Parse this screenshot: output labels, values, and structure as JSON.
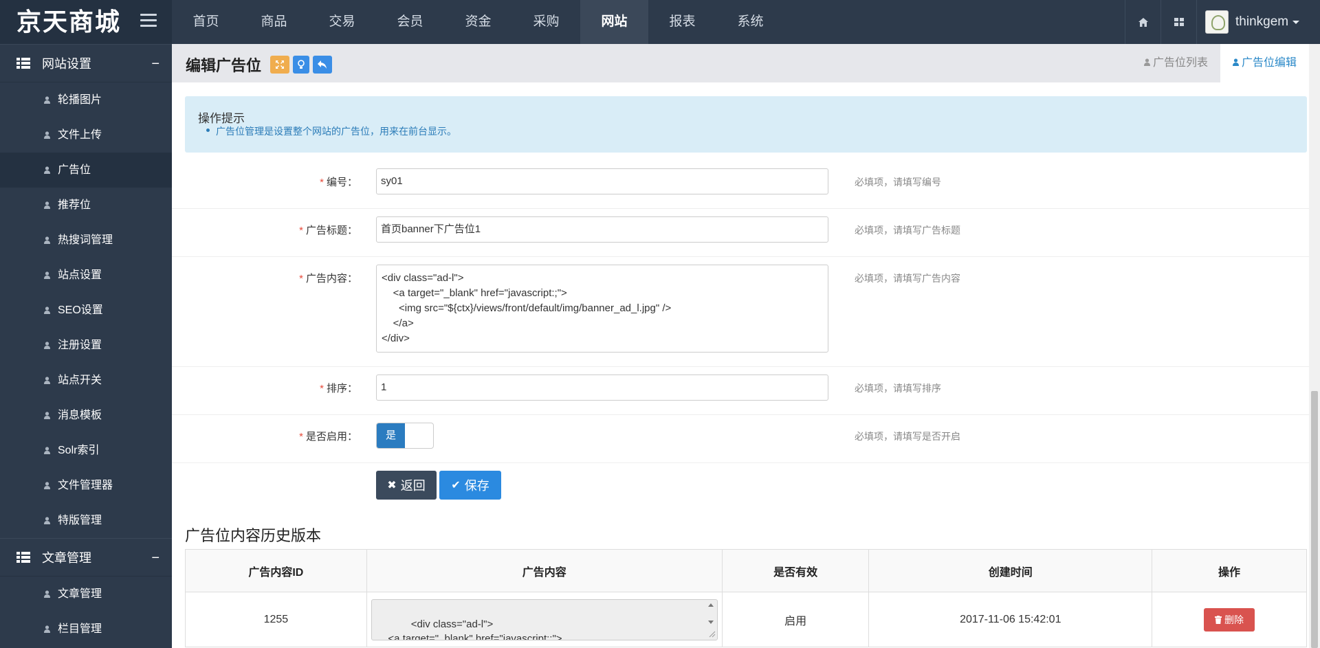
{
  "app": {
    "brand": "京天商城"
  },
  "topnav": {
    "items": [
      "首页",
      "商品",
      "交易",
      "会员",
      "资金",
      "采购",
      "网站",
      "报表",
      "系统"
    ],
    "active_index": 6
  },
  "user": {
    "name": "thinkgem"
  },
  "sidebar": {
    "groups": [
      {
        "title": "网站设置",
        "toggle": "−",
        "items": [
          "轮播图片",
          "文件上传",
          "广告位",
          "推荐位",
          "热搜词管理",
          "站点设置",
          "SEO设置",
          "注册设置",
          "站点开关",
          "消息模板",
          "Solr索引",
          "文件管理器",
          "特版管理"
        ],
        "active_index": 2
      },
      {
        "title": "文章管理",
        "toggle": "−",
        "items": [
          "文章管理",
          "栏目管理"
        ]
      }
    ]
  },
  "page": {
    "title": "编辑广告位",
    "tabs": [
      {
        "label": "广告位列表",
        "active": false
      },
      {
        "label": "广告位编辑",
        "active": true
      }
    ]
  },
  "tips": {
    "title": "操作提示",
    "items": [
      "广告位管理是设置整个网站的广告位，用来在前台显示。"
    ]
  },
  "form": {
    "required_mark": "*",
    "code": {
      "label": "编号：",
      "value": "sy01",
      "hint": "必填项，请填写编号"
    },
    "title": {
      "label": "广告标题：",
      "value": "首页banner下广告位1",
      "hint": "必填项，请填写广告标题"
    },
    "content": {
      "label": "广告内容：",
      "value": "<div class=\"ad-l\">\n    <a target=\"_blank\" href=\"javascript:;\">\n      <img src=\"${ctx}/views/front/default/img/banner_ad_l.jpg\" />\n    </a>\n</div>",
      "hint": "必填项，请填写广告内容"
    },
    "sort": {
      "label": "排序：",
      "value": "1",
      "hint": "必填项，请填写排序"
    },
    "enabled": {
      "label": "是否启用：",
      "on_label": "是",
      "hint": "必填项，请填写是否开启"
    },
    "back_label": "返回",
    "save_label": "保存"
  },
  "history": {
    "title": "广告位内容历史版本",
    "columns": [
      "广告内容ID",
      "广告内容",
      "是否有效",
      "创建时间",
      "操作"
    ],
    "rows": [
      {
        "id": "1255",
        "content": "<div class=\"ad-l\">\n    <a target=\"_blank\" href=\"javascript:;\">\n      <img src=\"${ctx}/views/front/default/img/banner_ad_l.jpg\" />",
        "status": "启用",
        "created": "2017-11-06 15:42:01",
        "action": "删除"
      }
    ]
  },
  "colors": {
    "nav_bg": "#2d3a4b",
    "brand_bg": "#243141",
    "accent_blue": "#2b8ae0",
    "danger": "#d9534f",
    "tips_bg": "#d9edf7"
  }
}
